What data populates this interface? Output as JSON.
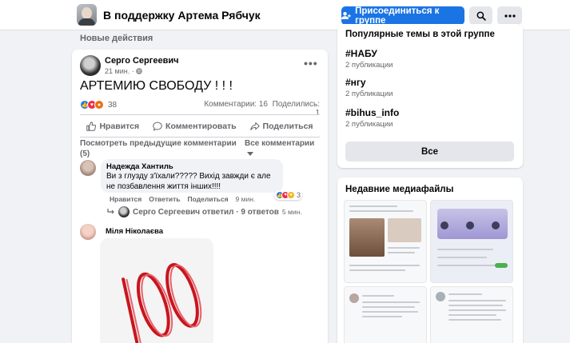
{
  "header": {
    "group_title": "В поддержку Артема Рябчук",
    "join_label": "Присоединиться к группе"
  },
  "feed": {
    "section_label": "Новые действия"
  },
  "post": {
    "author": "Серго Сергеевич",
    "time": "21 мин. · ",
    "text": "АРТЕМИЮ СВОБОДУ ! ! !",
    "reaction_count": "38",
    "comments_label": "Комментарии: 16",
    "shares_label": "Поделились: 1",
    "actions": {
      "like": "Нравится",
      "comment": "Комментировать",
      "share": "Поделиться"
    },
    "prev_comments": "Посмотреть предыдущие комментарии (5)",
    "all_comments": "Все комментарии"
  },
  "comments": [
    {
      "name": "Надежда Хантиль",
      "text": "Ви з глузду з'їхали????? Вихід завжди є але не позбавлення життя інших!!!!",
      "like": "Нравится",
      "reply": "Ответить",
      "share": "Поделиться",
      "time": "9 мин.",
      "reaction_count": "3",
      "reply_summary": "Серго Сергеевич ответил · 9 ответов",
      "reply_time": "5 мин."
    },
    {
      "name": "Міля Ніколаєва"
    }
  ],
  "sidebar": {
    "topics_title": "Популярные темы в этой группе",
    "topics": [
      {
        "tag": "#НАБУ",
        "count": "2 публикации"
      },
      {
        "tag": "#нгу",
        "count": "2 публикации"
      },
      {
        "tag": "#bihus_info",
        "count": "2 публикации"
      }
    ],
    "all_label": "Все",
    "media_title": "Недавние медиафайлы"
  },
  "colors": {
    "primary": "#1b74e4",
    "background": "#f0f2f5",
    "card": "#ffffff",
    "secondary_text": "#65676b",
    "like": "#1877f2",
    "love": "#f02849",
    "angry": "#e9710f",
    "sticker_red": "#c9151e"
  }
}
